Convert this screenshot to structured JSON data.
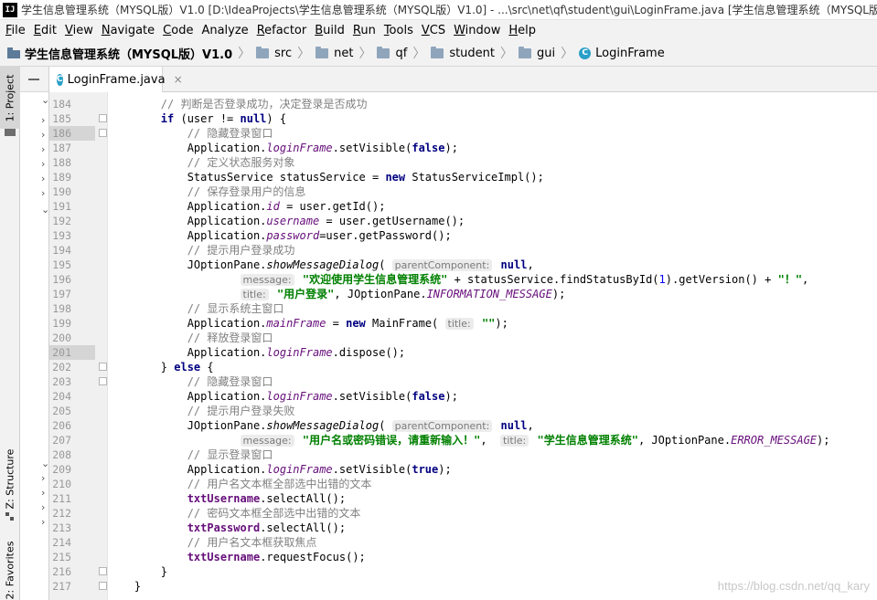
{
  "window": {
    "app_icon": "IJ",
    "title": "学生信息管理系统（MYSQL版）V1.0 [D:\\IdeaProjects\\学生信息管理系统（MYSQL版）V1.0] - ...\\src\\net\\qf\\student\\gui\\LoginFrame.java [学生信息管理系统（MYSQL版）"
  },
  "menu": [
    {
      "label": "File",
      "mn": "F",
      "rest": "ile"
    },
    {
      "label": "Edit",
      "mn": "E",
      "rest": "dit"
    },
    {
      "label": "View",
      "mn": "V",
      "rest": "iew"
    },
    {
      "label": "Navigate",
      "mn": "N",
      "rest": "avigate"
    },
    {
      "label": "Code",
      "mn": "C",
      "rest": "ode"
    },
    {
      "label": "Analyze",
      "mn": "",
      "rest": "Analyze"
    },
    {
      "label": "Refactor",
      "mn": "R",
      "rest": "efactor"
    },
    {
      "label": "Build",
      "mn": "B",
      "rest": "uild"
    },
    {
      "label": "Run",
      "mn": "R",
      "rest": "un"
    },
    {
      "label": "Tools",
      "mn": "T",
      "rest": "ools"
    },
    {
      "label": "VCS",
      "mn": "V",
      "rest": "CS"
    },
    {
      "label": "Window",
      "mn": "W",
      "rest": "indow"
    },
    {
      "label": "Help",
      "mn": "H",
      "rest": "elp"
    }
  ],
  "breadcrumb": {
    "project": "学生信息管理系统（MYSQL版）V1.0",
    "folders": [
      "src",
      "net",
      "qf",
      "student",
      "gui"
    ],
    "file": "LoginFrame",
    "separator": "〉"
  },
  "side_tabs": {
    "project": "1: Project",
    "structure": "Z: Structure",
    "favorites": "2: Favorites"
  },
  "editor_tab": {
    "label": "LoginFrame.java",
    "close": "×",
    "icon": "C"
  },
  "code": {
    "highlight_lines": [
      186,
      201
    ],
    "fold_lines": [
      185,
      186,
      202,
      203,
      216,
      217
    ],
    "lines": [
      {
        "n": "184",
        "tokens": [
          [
            "",
            "        "
          ],
          [
            "cm",
            "// 判断是否登录成功，决定登录是否成功"
          ]
        ]
      },
      {
        "n": "185",
        "tokens": [
          [
            "",
            "        "
          ],
          [
            "kw",
            "if"
          ],
          [
            "",
            " (user != "
          ],
          [
            "kw",
            "null"
          ],
          [
            "",
            ") {"
          ]
        ]
      },
      {
        "n": "186",
        "tokens": [
          [
            "",
            "            "
          ],
          [
            "cm",
            "// 隐藏登录窗口"
          ]
        ]
      },
      {
        "n": "187",
        "tokens": [
          [
            "",
            "            Application."
          ],
          [
            "fld",
            "loginFrame"
          ],
          [
            "",
            ".setVisible("
          ],
          [
            "kw",
            "false"
          ],
          [
            "",
            ");"
          ]
        ]
      },
      {
        "n": "188",
        "tokens": [
          [
            "",
            "            "
          ],
          [
            "cm",
            "// 定义状态服务对象"
          ]
        ]
      },
      {
        "n": "189",
        "tokens": [
          [
            "",
            "            StatusService statusService = "
          ],
          [
            "kw",
            "new"
          ],
          [
            "",
            " StatusServiceImpl();"
          ]
        ]
      },
      {
        "n": "190",
        "tokens": [
          [
            "",
            "            "
          ],
          [
            "cm",
            "// 保存登录用户的信息"
          ]
        ]
      },
      {
        "n": "191",
        "tokens": [
          [
            "",
            "            Application."
          ],
          [
            "fld",
            "id"
          ],
          [
            "",
            " = user.getId();"
          ]
        ]
      },
      {
        "n": "192",
        "tokens": [
          [
            "",
            "            Application."
          ],
          [
            "fld",
            "username"
          ],
          [
            "",
            " = user.getUsername();"
          ]
        ]
      },
      {
        "n": "193",
        "tokens": [
          [
            "",
            "            Application."
          ],
          [
            "fld",
            "password"
          ],
          [
            "",
            "=user.getPassword();"
          ]
        ]
      },
      {
        "n": "194",
        "tokens": [
          [
            "",
            "            "
          ],
          [
            "cm",
            "// 提示用户登录成功"
          ]
        ]
      },
      {
        "n": "195",
        "tokens": [
          [
            "",
            "            JOptionPane."
          ],
          [
            "sm",
            "showMessageDialog"
          ],
          [
            "",
            "( "
          ],
          [
            "hint",
            "parentComponent:"
          ],
          [
            "",
            " "
          ],
          [
            "kw",
            "null"
          ],
          [
            "",
            ","
          ]
        ]
      },
      {
        "n": "196",
        "tokens": [
          [
            "",
            "                    "
          ],
          [
            "hint",
            "message:"
          ],
          [
            "",
            " "
          ],
          [
            "str",
            "\"欢迎使用学生信息管理系统\""
          ],
          [
            "",
            " + statusService.findStatusById("
          ],
          [
            "num",
            "1"
          ],
          [
            "",
            ").getVersion() + "
          ],
          [
            "str",
            "\"！\""
          ],
          [
            "",
            ","
          ]
        ]
      },
      {
        "n": "197",
        "tokens": [
          [
            "",
            "                    "
          ],
          [
            "hint",
            "title:"
          ],
          [
            "",
            " "
          ],
          [
            "str",
            "\"用户登录\""
          ],
          [
            "",
            ", JOptionPane."
          ],
          [
            "fld",
            "INFORMATION_MESSAGE"
          ],
          [
            "",
            ");"
          ]
        ]
      },
      {
        "n": "198",
        "tokens": [
          [
            "",
            "            "
          ],
          [
            "cm",
            "// 显示系统主窗口"
          ]
        ]
      },
      {
        "n": "199",
        "tokens": [
          [
            "",
            "            Application."
          ],
          [
            "fld",
            "mainFrame"
          ],
          [
            "",
            " = "
          ],
          [
            "kw",
            "new"
          ],
          [
            "",
            " MainFrame( "
          ],
          [
            "hint",
            "title:"
          ],
          [
            "",
            " "
          ],
          [
            "str",
            "\"\""
          ],
          [
            "",
            ");"
          ]
        ]
      },
      {
        "n": "200",
        "tokens": [
          [
            "",
            "            "
          ],
          [
            "cm",
            "// 释放登录窗口"
          ]
        ]
      },
      {
        "n": "201",
        "tokens": [
          [
            "",
            "            Application."
          ],
          [
            "fld",
            "loginFrame"
          ],
          [
            "",
            ".dispose();"
          ]
        ]
      },
      {
        "n": "202",
        "tokens": [
          [
            "",
            "        } "
          ],
          [
            "kw",
            "else"
          ],
          [
            "",
            " {"
          ]
        ]
      },
      {
        "n": "203",
        "tokens": [
          [
            "",
            "            "
          ],
          [
            "cm",
            "// 隐藏登录窗口"
          ]
        ]
      },
      {
        "n": "204",
        "tokens": [
          [
            "",
            "            Application."
          ],
          [
            "fld",
            "loginFrame"
          ],
          [
            "",
            ".setVisible("
          ],
          [
            "kw",
            "false"
          ],
          [
            "",
            ");"
          ]
        ]
      },
      {
        "n": "205",
        "tokens": [
          [
            "",
            "            "
          ],
          [
            "cm",
            "// 提示用户登录失败"
          ]
        ]
      },
      {
        "n": "206",
        "tokens": [
          [
            "",
            "            JOptionPane."
          ],
          [
            "sm",
            "showMessageDialog"
          ],
          [
            "",
            "( "
          ],
          [
            "hint",
            "parentComponent:"
          ],
          [
            "",
            " "
          ],
          [
            "kw",
            "null"
          ],
          [
            "",
            ","
          ]
        ]
      },
      {
        "n": "207",
        "tokens": [
          [
            "",
            "                    "
          ],
          [
            "hint",
            "message:"
          ],
          [
            "",
            " "
          ],
          [
            "str",
            "\"用户名或密码错误，请重新输入！\""
          ],
          [
            "",
            ",  "
          ],
          [
            "hint",
            "title:"
          ],
          [
            "",
            " "
          ],
          [
            "str",
            "\"学生信息管理系统\""
          ],
          [
            "",
            ", JOptionPane."
          ],
          [
            "fld",
            "ERROR_MESSAGE"
          ],
          [
            "",
            ");"
          ]
        ]
      },
      {
        "n": "208",
        "tokens": [
          [
            "",
            "            "
          ],
          [
            "cm",
            "// 显示登录窗口"
          ]
        ]
      },
      {
        "n": "209",
        "tokens": [
          [
            "",
            "            Application."
          ],
          [
            "fld",
            "loginFrame"
          ],
          [
            "",
            ".setVisible("
          ],
          [
            "kw",
            "true"
          ],
          [
            "",
            ");"
          ]
        ]
      },
      {
        "n": "210",
        "tokens": [
          [
            "",
            "            "
          ],
          [
            "cm",
            "// 用户名文本框全部选中出错的文本"
          ]
        ]
      },
      {
        "n": "211",
        "tokens": [
          [
            "",
            "            "
          ],
          [
            "ifld",
            "txtUsername"
          ],
          [
            "",
            ".selectAll();"
          ]
        ]
      },
      {
        "n": "212",
        "tokens": [
          [
            "",
            "            "
          ],
          [
            "cm",
            "// 密码文本框全部选中出错的文本"
          ]
        ]
      },
      {
        "n": "213",
        "tokens": [
          [
            "",
            "            "
          ],
          [
            "ifld",
            "txtPassword"
          ],
          [
            "",
            ".selectAll();"
          ]
        ]
      },
      {
        "n": "214",
        "tokens": [
          [
            "",
            "            "
          ],
          [
            "cm",
            "// 用户名文本框获取焦点"
          ]
        ]
      },
      {
        "n": "215",
        "tokens": [
          [
            "",
            "            "
          ],
          [
            "ifld",
            "txtUsername"
          ],
          [
            "",
            ".requestFocus();"
          ]
        ]
      },
      {
        "n": "216",
        "tokens": [
          [
            "",
            "        }"
          ]
        ]
      },
      {
        "n": "217",
        "tokens": [
          [
            "",
            "    }"
          ]
        ]
      }
    ]
  },
  "colors": {
    "keyword": "#000080",
    "comment": "#808080",
    "field": "#660e7a",
    "string": "#008000",
    "number": "#0000ff"
  },
  "watermark": "https://blog.csdn.net/qq_kary"
}
